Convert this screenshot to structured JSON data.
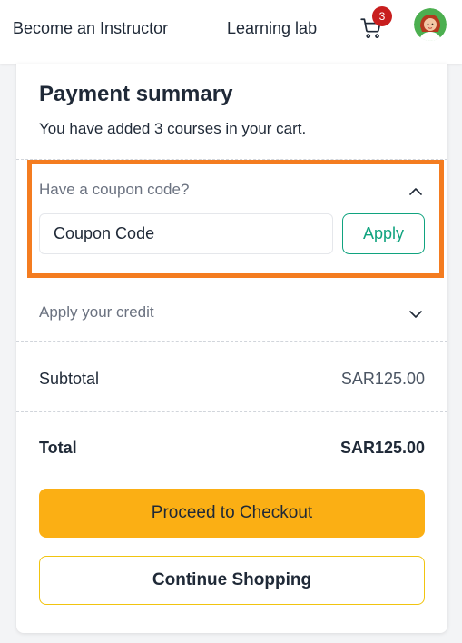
{
  "nav": {
    "instructor": "Become an Instructor",
    "learning_lab": "Learning lab",
    "cart_icon": "cart-icon",
    "cart_count": "3",
    "avatar_icon": "user-avatar"
  },
  "summary": {
    "title": "Payment summary",
    "subtitle": "You have added 3 courses in your cart."
  },
  "coupon": {
    "label": "Have a coupon code?",
    "placeholder": "Coupon Code",
    "value": "",
    "apply": "Apply",
    "expanded_icon": "chevron-up-icon"
  },
  "credit": {
    "label": "Apply your credit",
    "collapsed_icon": "chevron-down-icon"
  },
  "totals": {
    "subtotal_label": "Subtotal",
    "subtotal_value": "SAR125.00",
    "total_label": "Total",
    "total_value": "SAR125.00"
  },
  "actions": {
    "checkout": "Proceed to Checkout",
    "continue": "Continue Shopping"
  },
  "colors": {
    "accent_orange_highlight": "#f47c20",
    "checkout_yellow": "#fbaf14",
    "apply_green": "#10a37f",
    "badge_red": "#c81e1e"
  }
}
